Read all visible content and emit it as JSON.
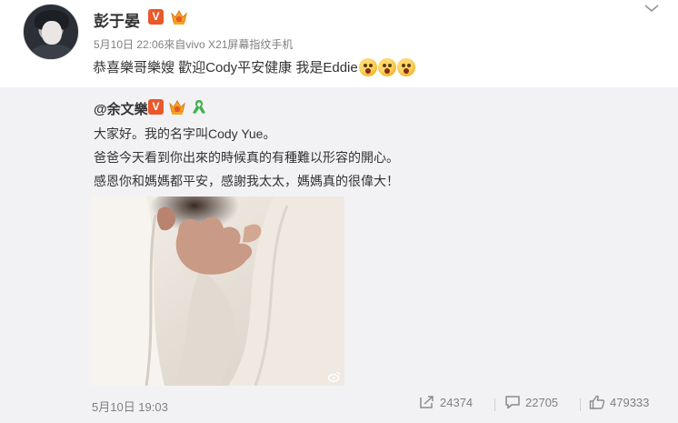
{
  "post": {
    "author": "彭于晏",
    "meta": "5月10日 22:06來自vivo X21屏幕指纹手机",
    "text": "恭喜樂哥樂嫂 歡迎Cody平安健康 我是Eddie",
    "emoji_count": 3,
    "icons": {
      "verified": "verified-v-icon",
      "vip": "vip-crown-icon",
      "menu": "chevron-down-icon",
      "emoji": "shocked-face-emoji"
    }
  },
  "repost": {
    "author": "@余文樂",
    "badge_v": "V",
    "lines": [
      "大家好。我的名字叫Cody Yue。",
      "爸爸今天看到你出來的時候真的有種難以形容的開心。",
      "感恩你和媽媽都平安，感謝我太太，媽媽真的很偉大！"
    ],
    "image": {
      "description_icon": "photo-weibo-watermark-icon"
    },
    "timestamp": "5月10日 19:03",
    "actions": {
      "repost_count": "24374",
      "comment_count": "22705",
      "like_count": "479333"
    }
  },
  "badge_v_text": "V",
  "colors": {
    "verified_orange": "#e8582a",
    "repost_bg": "#f2f2f5",
    "meta_gray": "#808080"
  }
}
